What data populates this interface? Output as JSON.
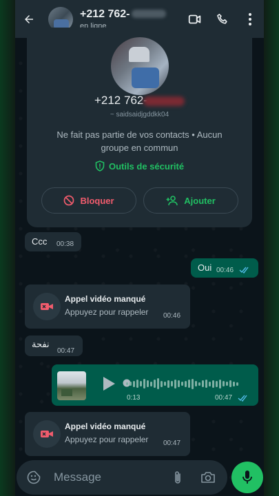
{
  "header": {
    "contact_name": "+212 762-",
    "status": "en ligne",
    "icons": [
      "back-arrow-icon",
      "video-call-icon",
      "phone-icon",
      "more-vert-icon"
    ]
  },
  "profile": {
    "phone": "+212 762-",
    "username": "~ saidsaidjgddkk04",
    "info": "Ne fait pas partie de vos contacts • Aucun groupe en commun",
    "security_label": "Outils de sécurité",
    "block_label": "Bloquer",
    "add_label": "Ajouter"
  },
  "messages": [
    {
      "dir": "in",
      "text": "Ccc",
      "time": "00:38"
    },
    {
      "dir": "out",
      "text": "Oui",
      "time": "00:46",
      "read": true
    },
    {
      "dir": "in",
      "type": "missed_video_call",
      "title": "Appel vidéo manqué",
      "subtitle": "Appuyez pour rappeler",
      "time": "00:46"
    },
    {
      "dir": "in",
      "text": "نفحة",
      "time": "00:47"
    },
    {
      "dir": "out",
      "type": "voice",
      "duration": "0:13",
      "time": "00:47",
      "read": true
    },
    {
      "dir": "in",
      "type": "missed_video_call",
      "title": "Appel vidéo manqué",
      "subtitle": "Appuyez pour rappeler",
      "time": "00:47"
    }
  ],
  "composer": {
    "placeholder": "Message"
  },
  "colors": {
    "accent": "#21c063",
    "out_bubble": "#005c4b",
    "in_bubble": "#1f2c34",
    "danger": "#f15c6d",
    "read_ticks": "#53bdeb"
  }
}
